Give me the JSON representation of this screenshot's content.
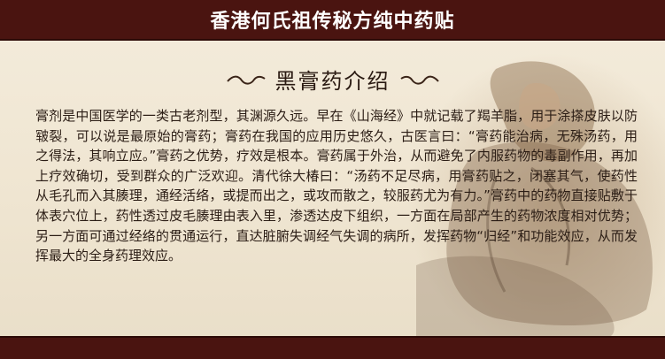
{
  "header": {
    "title": "香港何氏祖传秘方纯中药贴"
  },
  "section": {
    "heading": "黑膏药介绍"
  },
  "article": {
    "paragraph": "膏剂是中国医学的一类古老剂型，其渊源久远。早在《山海经》中就记载了羯羊脂，用于涂搽皮肤以防皲裂，可以说是最原始的膏药；膏药在我国的应用历史悠久，古医言曰：“膏药能治病，无殊汤药，用之得法，其响立应。”膏药之优势，疗效是根本。膏药属于外治，从而避免了内服药物的毒副作用，再加上疗效确切，受到群众的广泛欢迎。清代徐大椿曰：“汤药不足尽病，用膏药贴之，闭塞其气，使药性从毛孔而入其腠理，通经活络，或提而出之，或攻而散之，较服药尤为有力。”膏药中的药物直接贴敷于体表穴位上，药性透过皮毛腠理由表入里，渗透达皮下组织，一方面在局部产生的药物浓度相对优势；另一方面可通过经络的贯通运行，直达脏腑失调经气失调的病所，发挥药物“归经”和功能效应，从而发挥最大的全身药理效应。"
  },
  "colors": {
    "banner": "#4a1410",
    "background": "#f2ead9",
    "text": "#2b1d15"
  }
}
